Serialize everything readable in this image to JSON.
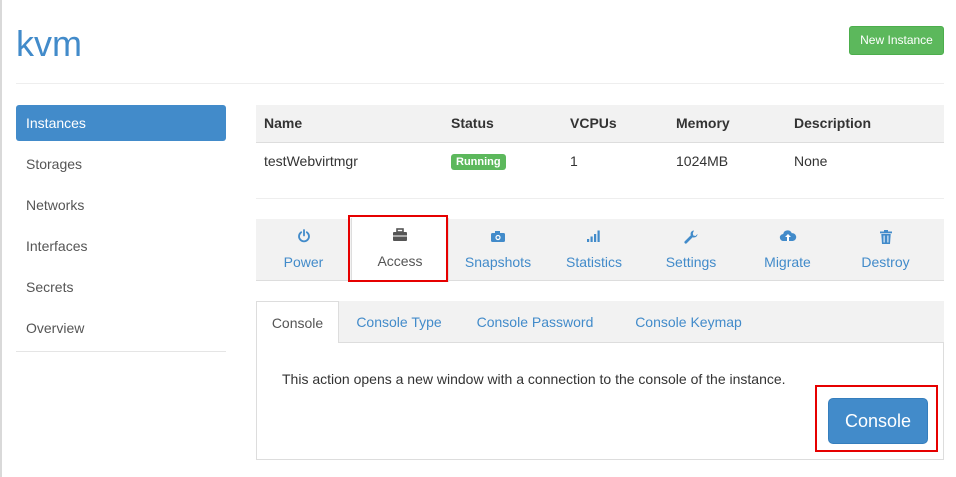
{
  "header": {
    "title": "kvm",
    "new_instance_label": "New Instance"
  },
  "sidebar": {
    "items": [
      {
        "label": "Instances",
        "active": true
      },
      {
        "label": "Storages"
      },
      {
        "label": "Networks"
      },
      {
        "label": "Interfaces"
      },
      {
        "label": "Secrets"
      },
      {
        "label": "Overview"
      }
    ]
  },
  "instances_table": {
    "columns": [
      "Name",
      "Status",
      "VCPUs",
      "Memory",
      "Description"
    ],
    "rows": [
      {
        "name": "testWebvirtmgr",
        "status": "Running",
        "vcpus": "1",
        "memory": "1024MB",
        "description": "None"
      }
    ]
  },
  "action_tabs": [
    {
      "label": "Power",
      "icon": "power-icon"
    },
    {
      "label": "Access",
      "icon": "briefcase-icon",
      "active": true
    },
    {
      "label": "Snapshots",
      "icon": "camera-icon"
    },
    {
      "label": "Statistics",
      "icon": "signal-bars-icon"
    },
    {
      "label": "Settings",
      "icon": "wrench-icon"
    },
    {
      "label": "Migrate",
      "icon": "cloud-upload-icon"
    },
    {
      "label": "Destroy",
      "icon": "trash-icon"
    }
  ],
  "access_subtabs": [
    {
      "label": "Console",
      "active": true
    },
    {
      "label": "Console Type"
    },
    {
      "label": "Console Password"
    },
    {
      "label": "Console Keymap"
    }
  ],
  "console_pane": {
    "description": "This action opens a new window with a connection to the console of the instance.",
    "button_label": "Console"
  },
  "colors": {
    "primary": "#428bca",
    "success": "#5cb85c",
    "highlight": "#e60000"
  }
}
